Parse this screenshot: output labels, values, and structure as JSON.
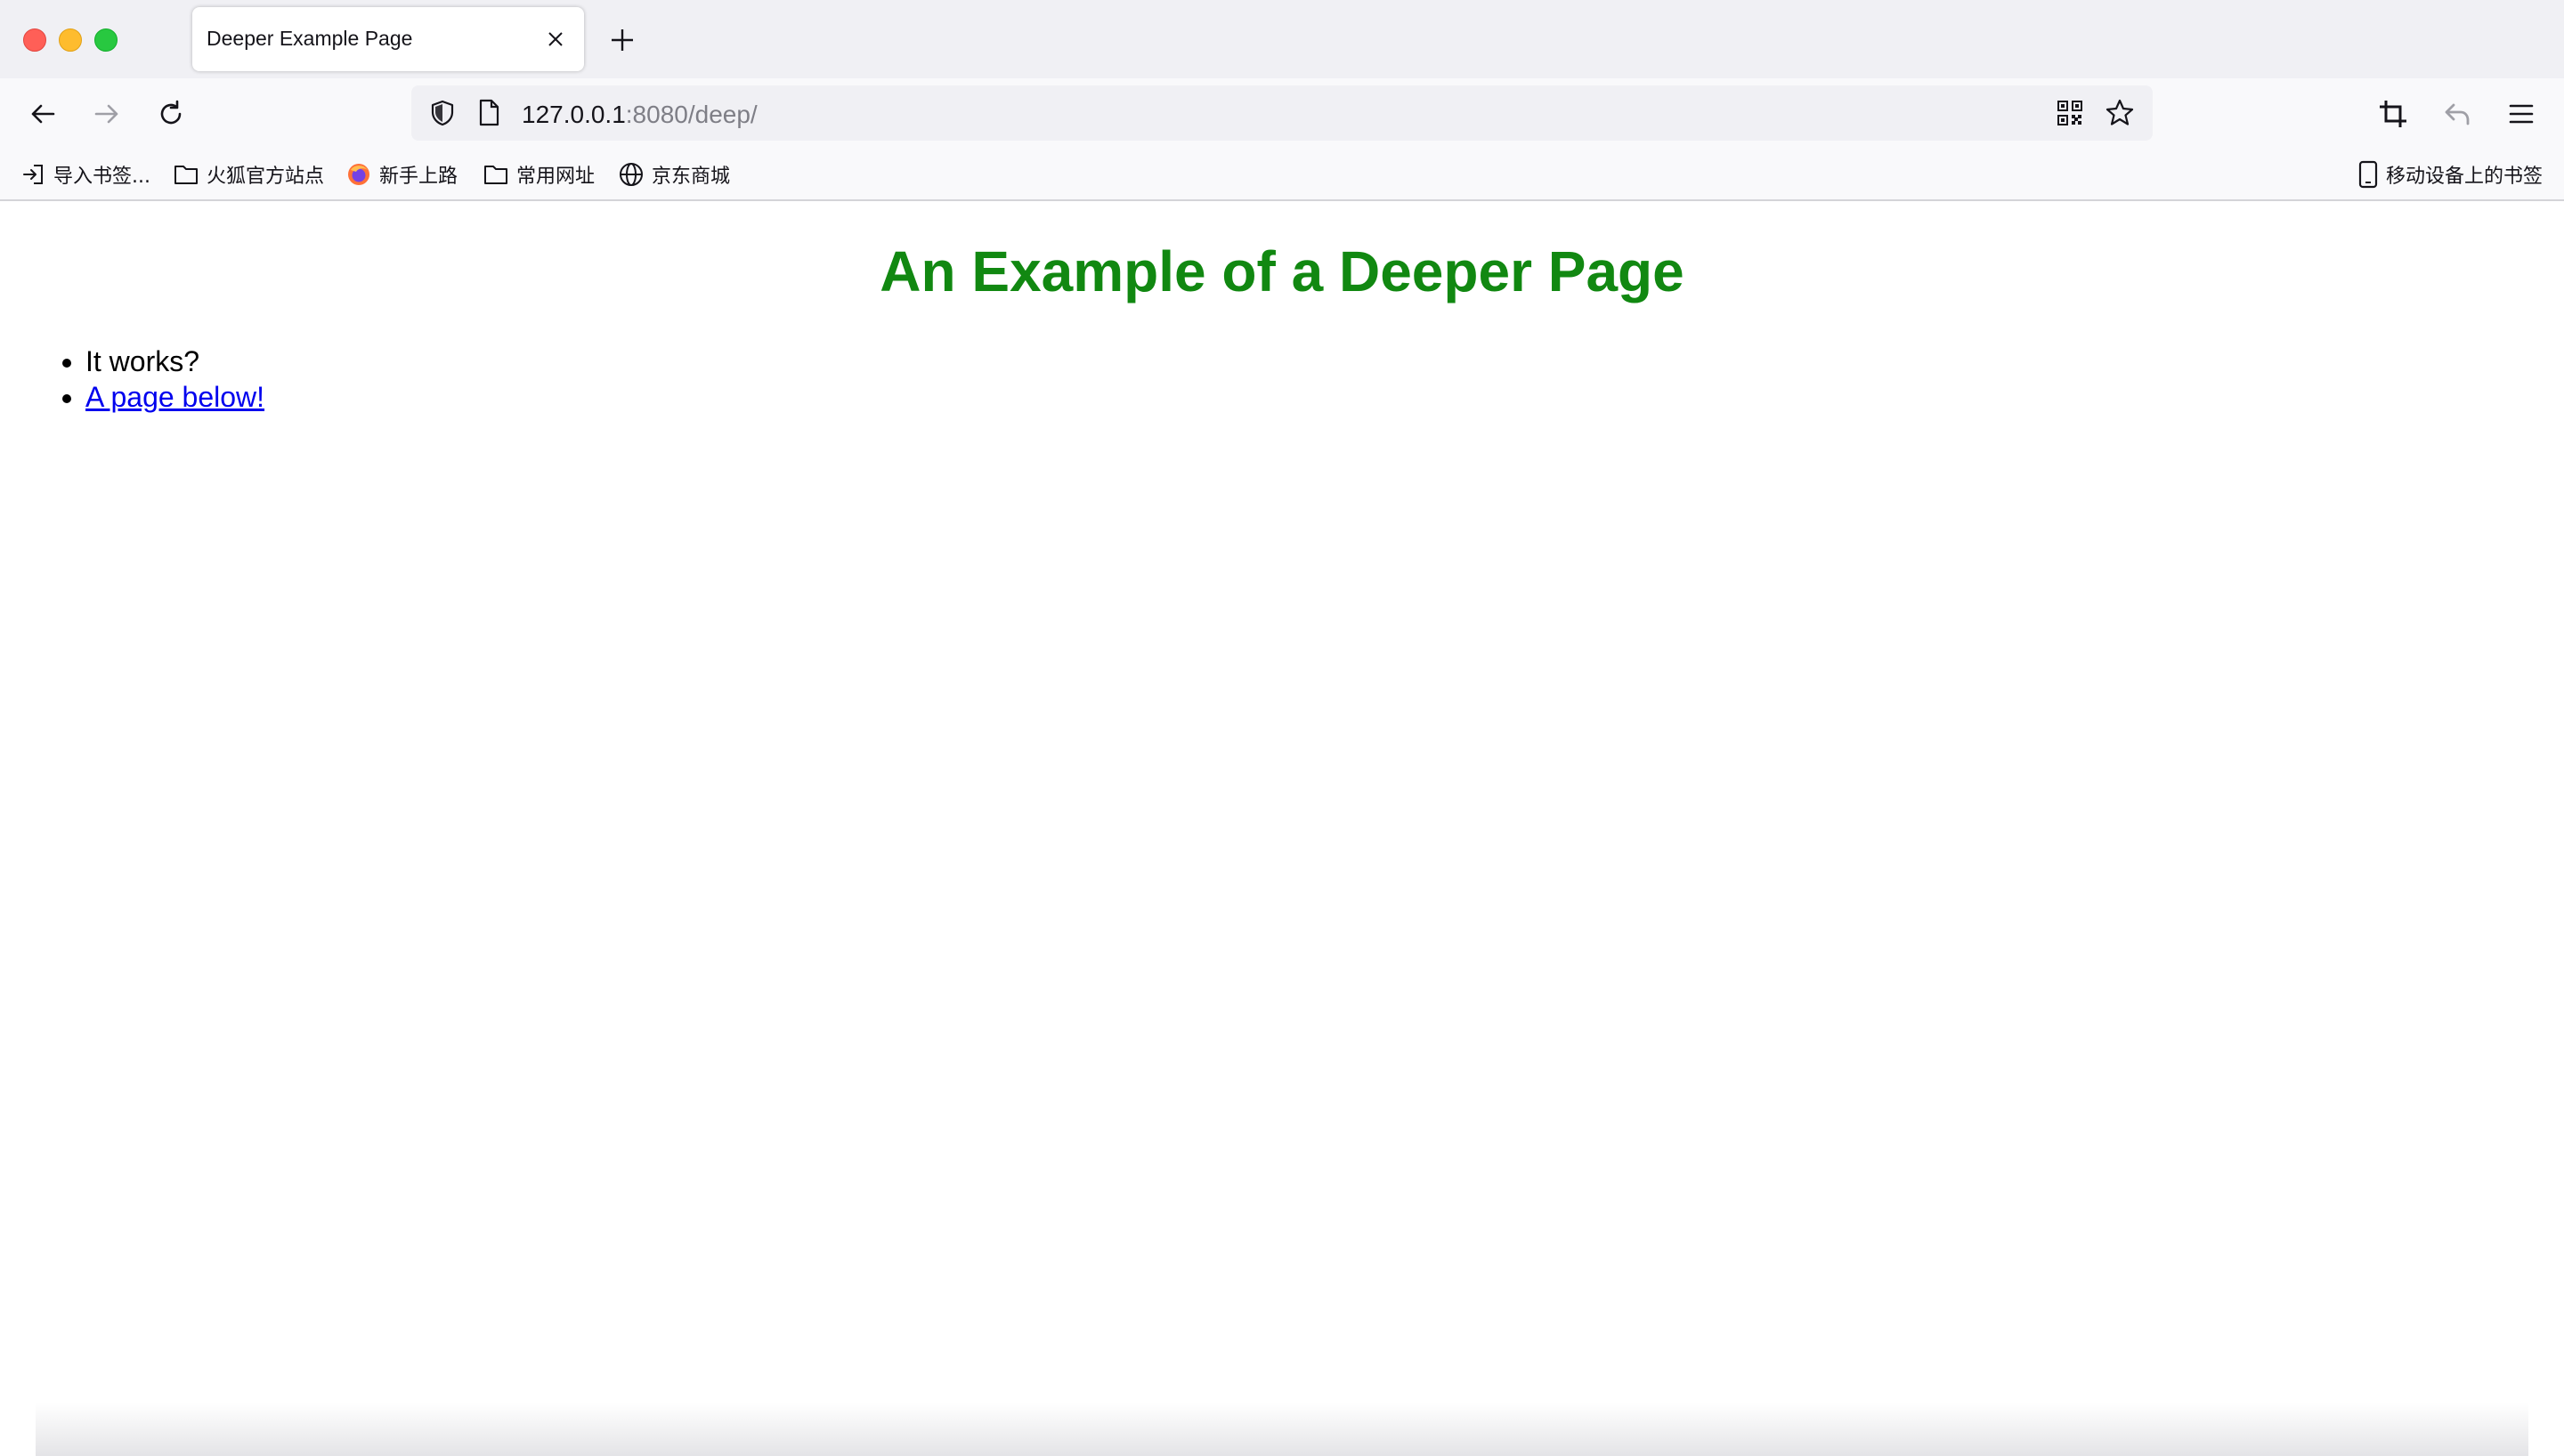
{
  "tab": {
    "title": "Deeper Example Page"
  },
  "url": {
    "host": "127.0.0.1",
    "rest": ":8080/deep/"
  },
  "bookmarks": [
    {
      "label": "导入书签...",
      "icon": "import-icon"
    },
    {
      "label": "火狐官方站点",
      "icon": "folder-icon"
    },
    {
      "label": "新手上路",
      "icon": "firefox-icon"
    },
    {
      "label": "常用网址",
      "icon": "folder-icon"
    },
    {
      "label": "京东商城",
      "icon": "globe-icon"
    }
  ],
  "mobile_bookmarks": "移动设备上的书签",
  "page": {
    "heading": "An Example of a Deeper Page",
    "items": [
      "It works?",
      "A page below!"
    ]
  },
  "colors": {
    "heading": "#118811",
    "link": "#0000ee"
  }
}
